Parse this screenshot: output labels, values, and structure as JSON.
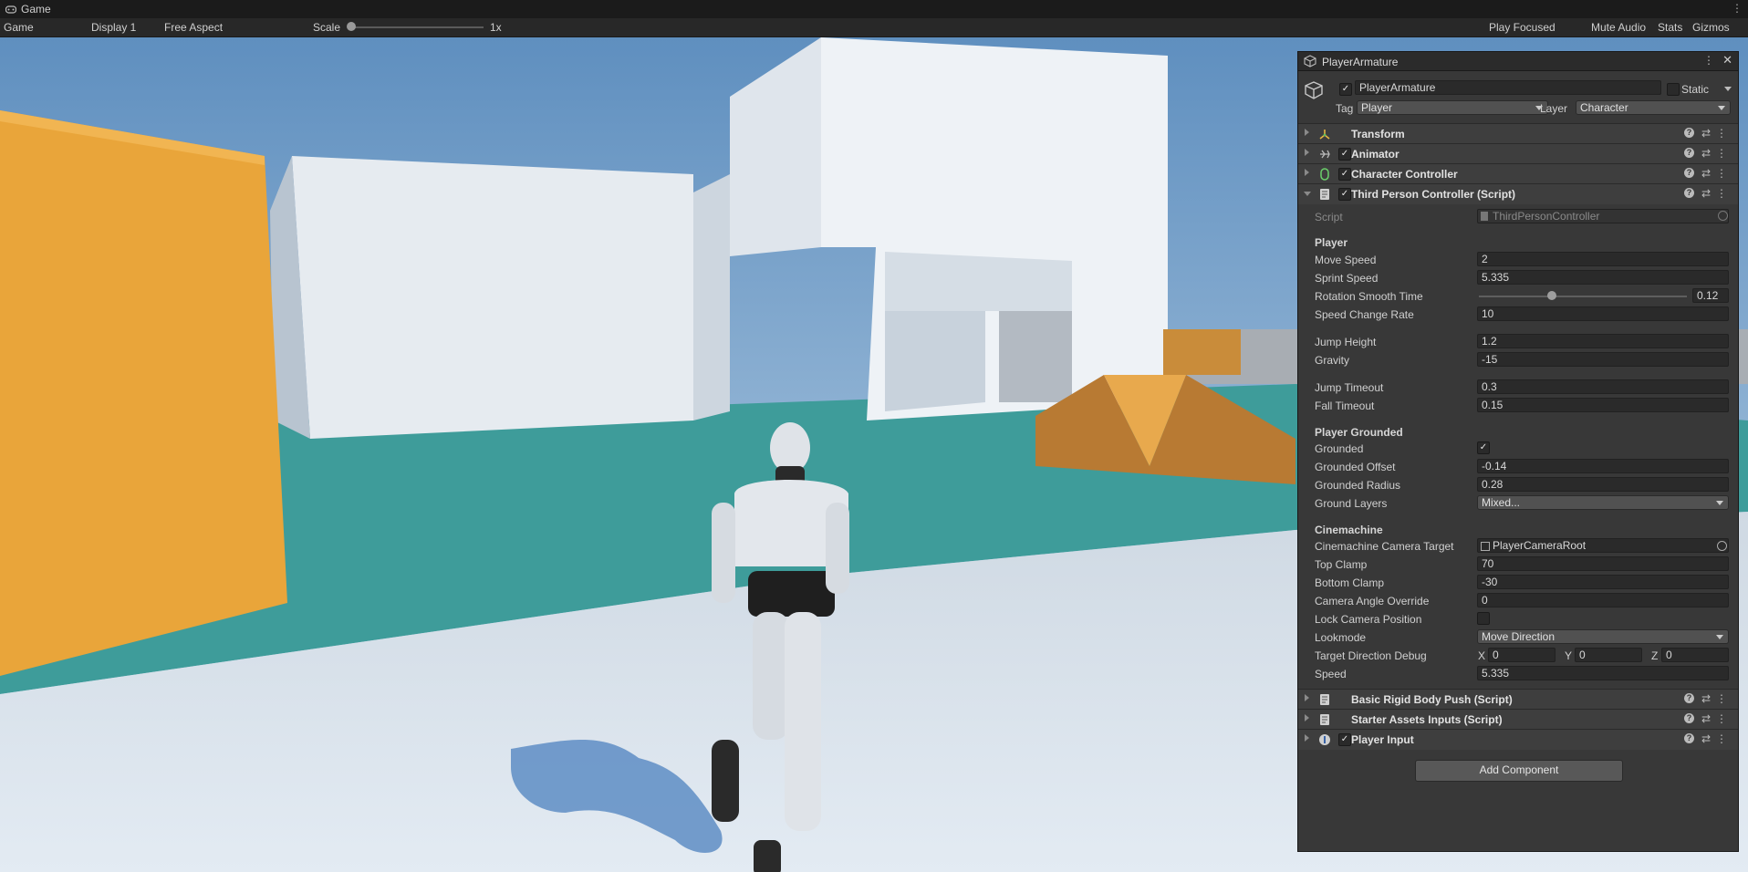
{
  "window": {
    "tab_title": "Game"
  },
  "toolbar": {
    "view_mode": "Game",
    "display": "Display 1",
    "aspect": "Free Aspect",
    "scale_label": "Scale",
    "scale_value": "1x",
    "play_focused": "Play Focused",
    "mute_audio": "Mute Audio",
    "stats": "Stats",
    "gizmos": "Gizmos"
  },
  "inspector": {
    "tab_title": "PlayerArmature",
    "object_name": "PlayerArmature",
    "static_label": "Static",
    "tag_label": "Tag",
    "tag_value": "Player",
    "layer_label": "Layer",
    "layer_value": "Character",
    "components": [
      {
        "name": "Transform"
      },
      {
        "name": "Animator"
      },
      {
        "name": "Character Controller"
      },
      {
        "name": "Third Person Controller (Script)"
      },
      {
        "name": "Basic Rigid Body Push (Script)"
      },
      {
        "name": "Starter Assets Inputs (Script)"
      },
      {
        "name": "Player Input"
      }
    ],
    "script": {
      "label": "Script",
      "value": "ThirdPersonController"
    },
    "sections": {
      "player": "Player",
      "grounded": "Player Grounded",
      "cinemachine": "Cinemachine"
    },
    "fields": {
      "move_speed": {
        "label": "Move Speed",
        "value": "2"
      },
      "sprint_speed": {
        "label": "Sprint Speed",
        "value": "5.335"
      },
      "rotation_smooth_time": {
        "label": "Rotation Smooth Time",
        "value": "0.12"
      },
      "speed_change_rate": {
        "label": "Speed Change Rate",
        "value": "10"
      },
      "jump_height": {
        "label": "Jump Height",
        "value": "1.2"
      },
      "gravity": {
        "label": "Gravity",
        "value": "-15"
      },
      "jump_timeout": {
        "label": "Jump Timeout",
        "value": "0.3"
      },
      "fall_timeout": {
        "label": "Fall Timeout",
        "value": "0.15"
      },
      "grounded": {
        "label": "Grounded"
      },
      "grounded_offset": {
        "label": "Grounded Offset",
        "value": "-0.14"
      },
      "grounded_radius": {
        "label": "Grounded Radius",
        "value": "0.28"
      },
      "ground_layers": {
        "label": "Ground Layers",
        "value": "Mixed..."
      },
      "camera_target": {
        "label": "Cinemachine Camera Target",
        "value": "PlayerCameraRoot"
      },
      "top_clamp": {
        "label": "Top Clamp",
        "value": "70"
      },
      "bottom_clamp": {
        "label": "Bottom Clamp",
        "value": "-30"
      },
      "camera_angle_override": {
        "label": "Camera Angle Override",
        "value": "0"
      },
      "lock_camera_position": {
        "label": "Lock Camera Position"
      },
      "lookmode": {
        "label": "Lookmode",
        "value": "Move Direction"
      },
      "target_direction_debug": {
        "label": "Target Direction Debug",
        "x_label": "X",
        "x": "0",
        "y_label": "Y",
        "y": "0",
        "z_label": "Z",
        "z": "0"
      },
      "speed": {
        "label": "Speed",
        "value": "5.335"
      }
    },
    "rotation_smooth_time_fraction": 0.35,
    "add_component": "Add Component"
  },
  "colors": {
    "accent_orange": "#e9a53a",
    "teal_floor": "#3e9c9a",
    "sky": "#8ab4d6"
  }
}
